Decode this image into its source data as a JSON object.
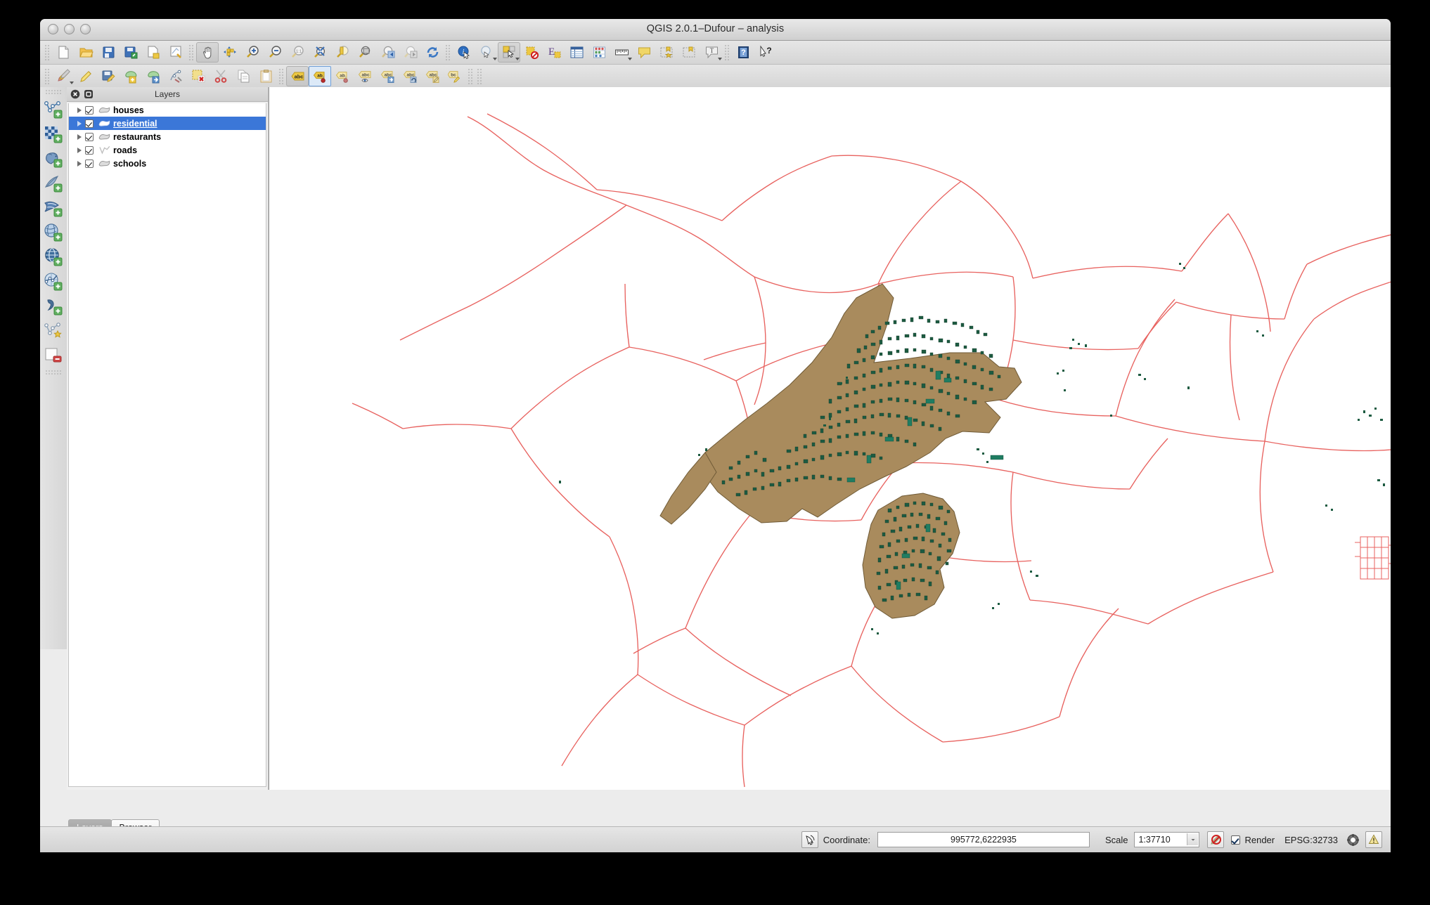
{
  "window": {
    "title": "QGIS 2.0.1–Dufour – analysis",
    "controls": [
      "close-button",
      "minimize-button",
      "zoom-button"
    ]
  },
  "toolbar_file": [
    {
      "name": "new-project-icon",
      "label": "New Project"
    },
    {
      "name": "open-project-icon",
      "label": "Open Project"
    },
    {
      "name": "save-project-icon",
      "label": "Save Project"
    },
    {
      "name": "save-project-as-icon",
      "label": "Save Project As"
    },
    {
      "name": "new-print-composer-icon",
      "label": "New Print Composer"
    },
    {
      "name": "composer-manager-icon",
      "label": "Composer Manager"
    }
  ],
  "toolbar_navigation": [
    {
      "name": "pan-map-icon",
      "label": "Pan Map",
      "active": true
    },
    {
      "name": "pan-to-selection-icon",
      "label": "Pan Map to Selection"
    },
    {
      "name": "zoom-in-icon",
      "label": "Zoom In"
    },
    {
      "name": "zoom-out-icon",
      "label": "Zoom Out"
    },
    {
      "name": "zoom-native-icon",
      "label": "Zoom to Native Resolution (1:1)"
    },
    {
      "name": "zoom-full-icon",
      "label": "Zoom Full"
    },
    {
      "name": "zoom-to-selection-icon",
      "label": "Zoom to Selection"
    },
    {
      "name": "zoom-to-layer-icon",
      "label": "Zoom to Layer"
    },
    {
      "name": "zoom-last-icon",
      "label": "Zoom Last"
    },
    {
      "name": "zoom-next-icon",
      "label": "Zoom Next"
    },
    {
      "name": "refresh-icon",
      "label": "Refresh"
    }
  ],
  "toolbar_attributes": [
    {
      "name": "identify-features-icon",
      "label": "Identify Features"
    },
    {
      "name": "select-features-icon",
      "label": "Select Features",
      "has_menu": true
    },
    {
      "name": "select-by-area-icon",
      "label": "Select Features by Area",
      "has_menu": true,
      "active": true
    },
    {
      "name": "deselect-features-icon",
      "label": "Deselect Features from All Layers"
    },
    {
      "name": "select-by-expression-icon",
      "label": "Select Features using an Expression"
    },
    {
      "name": "open-attribute-table-icon",
      "label": "Open Attribute Table"
    },
    {
      "name": "statistics-icon",
      "label": "Show Statistics"
    },
    {
      "name": "measure-line-icon",
      "label": "Measure Line",
      "has_menu": true
    },
    {
      "name": "map-tips-icon",
      "label": "Show Map Tips"
    },
    {
      "name": "new-bookmark-icon",
      "label": "New Bookmark"
    },
    {
      "name": "show-bookmarks-icon",
      "label": "Show Bookmarks"
    },
    {
      "name": "text-annotation-icon",
      "label": "Text Annotation",
      "has_menu": true
    },
    {
      "name": "help-icon",
      "label": "Help Contents"
    },
    {
      "name": "whats-this-icon",
      "label": "What's This?"
    }
  ],
  "toolbar_digitizing": [
    {
      "name": "current-edits-icon",
      "label": "Current Edits",
      "has_menu": true
    },
    {
      "name": "toggle-editing-icon",
      "label": "Toggle Editing"
    },
    {
      "name": "save-layer-edits-icon",
      "label": "Save Layer Edits"
    },
    {
      "name": "add-feature-icon",
      "label": "Add Feature"
    },
    {
      "name": "move-feature-icon",
      "label": "Move Feature"
    },
    {
      "name": "node-tool-icon",
      "label": "Node Tool"
    },
    {
      "name": "delete-selected-icon",
      "label": "Delete Selected"
    },
    {
      "name": "cut-features-icon",
      "label": "Cut Features"
    },
    {
      "name": "copy-features-icon",
      "label": "Copy Features"
    },
    {
      "name": "paste-features-icon",
      "label": "Paste Features"
    }
  ],
  "toolbar_label": [
    {
      "name": "layer-labeling-options-icon",
      "label": "Layer Labeling Options",
      "active": true
    },
    {
      "name": "pin-labels-icon",
      "label": "Pin/Unpin Labels",
      "selected": true
    },
    {
      "name": "highlight-pinned-labels-icon",
      "label": "Highlight Pinned Labels"
    },
    {
      "name": "show-hide-labels-icon",
      "label": "Show/Hide Labels"
    },
    {
      "name": "move-label-icon",
      "label": "Move Label"
    },
    {
      "name": "rotate-label-icon",
      "label": "Rotate Label"
    },
    {
      "name": "change-label-icon",
      "label": "Change Label"
    },
    {
      "name": "edit-label-icon",
      "label": "Edit Label"
    }
  ],
  "toolbar_layers": [
    {
      "name": "add-vector-layer-icon",
      "label": "Add Vector Layer"
    },
    {
      "name": "add-raster-layer-icon",
      "label": "Add Raster Layer"
    },
    {
      "name": "add-postgis-layer-icon",
      "label": "Add PostGIS Layer"
    },
    {
      "name": "add-spatialite-layer-icon",
      "label": "Add SpatiaLite Layer"
    },
    {
      "name": "add-mssql-layer-icon",
      "label": "Add MSSQL Spatial Layer"
    },
    {
      "name": "add-wcs-layer-icon",
      "label": "Add WCS Layer"
    },
    {
      "name": "add-wfs-layer-icon",
      "label": "Add WFS Layer"
    },
    {
      "name": "add-wms-layer-icon",
      "label": "Add WMS Layer"
    },
    {
      "name": "add-delimited-text-layer-icon",
      "label": "Add Delimited Text Layer"
    },
    {
      "name": "new-shapefile-layer-icon",
      "label": "New Shapefile Layer"
    },
    {
      "name": "remove-layer-icon",
      "label": "Remove Layer"
    }
  ],
  "panel": {
    "title": "Layers",
    "close_button": "close-panel-icon",
    "float_button": "float-panel-icon",
    "layers": [
      {
        "name": "houses",
        "checked": true,
        "selected": false,
        "symbol": "polygon-symbol",
        "symbol_color": "#d9d9d9"
      },
      {
        "name": "residential",
        "checked": true,
        "selected": true,
        "symbol": "polygon-symbol",
        "symbol_color": "#ffffff"
      },
      {
        "name": "restaurants",
        "checked": true,
        "selected": false,
        "symbol": "polygon-symbol",
        "symbol_color": "#d9d9d9"
      },
      {
        "name": "roads",
        "checked": true,
        "selected": false,
        "symbol": "line-symbol",
        "symbol_color": "#cfcfcf"
      },
      {
        "name": "schools",
        "checked": true,
        "selected": false,
        "symbol": "polygon-symbol",
        "symbol_color": "#d9d9d9"
      }
    ],
    "tabs": [
      {
        "label": "Layers",
        "active": true
      },
      {
        "label": "Browser",
        "active": false
      }
    ]
  },
  "map": {
    "residential_fill": "#a98b5d",
    "buildings_fill": "#1d5b41",
    "roads_stroke": "#e8625f",
    "background": "#ffffff"
  },
  "status_bar": {
    "lock_icon": "coordinate-capture-icon",
    "coordinate_label": "Coordinate:",
    "coordinate_value": "995772,6222935",
    "scale_label": "Scale",
    "scale_value": "1:37710",
    "stop_render_icon": "stop-render-icon",
    "render_label": "Render",
    "render_checked": true,
    "crs_label": "EPSG:32733",
    "crs_icon": "crs-status-icon",
    "messages_icon": "messages-warning-icon"
  }
}
